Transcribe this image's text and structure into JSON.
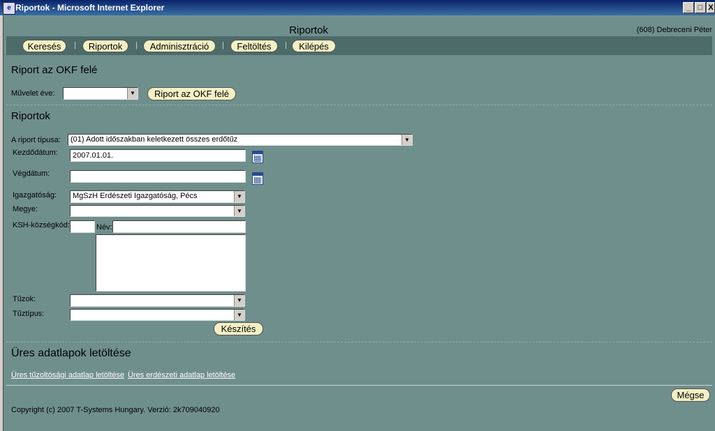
{
  "window": {
    "title": "Riportok - Microsoft Internet Explorer",
    "min_label": "_",
    "max_label": "□",
    "close_label": "X"
  },
  "header": {
    "page_title": "Riportok",
    "user": "(608) Debreceni Péter"
  },
  "nav": {
    "items": [
      {
        "label": "Keresés"
      },
      {
        "label": "Riportok"
      },
      {
        "label": "Adminisztráció"
      },
      {
        "label": "Feltöltés"
      },
      {
        "label": "Kilépés"
      }
    ],
    "separator": "|"
  },
  "okf": {
    "heading": "Riport az OKF felé",
    "year_label": "Művelet éve:",
    "year_value": "",
    "button": "Riport az OKF felé"
  },
  "reports": {
    "heading": "Riportok",
    "type_label": "A riport típusa:",
    "type_value": "(01) Adott időszakban keletkezett összes erdőtűz",
    "start_label": "Kezdődátum:",
    "start_value": "2007.01.01.",
    "end_label": "Végdátum:",
    "end_value": "",
    "directorate_label": "Igazgatóság:",
    "directorate_value": "MgSzH Erdészeti Igazgatóság, Pécs",
    "county_label": "Megye:",
    "county_value": "",
    "ksh_label": "KSH-községkód:",
    "ksh_value": "",
    "name_label": "Név:",
    "name_value": "",
    "fire_label": "Tűzok:",
    "fire_value": "",
    "firetype_label": "Tűztípus:",
    "firetype_value": "",
    "make_button": "Készítés"
  },
  "blank": {
    "heading": "Üres adatlapok letöltése",
    "link1": "Üres tűzoltósági adatlap letöltése",
    "link2": "Üres erdészeti adatlap letöltése"
  },
  "footer": {
    "cancel_button": "Mégse",
    "copyright": "Copyright (c) 2007 T-Systems Hungary. Verzió: 2k709040920"
  }
}
